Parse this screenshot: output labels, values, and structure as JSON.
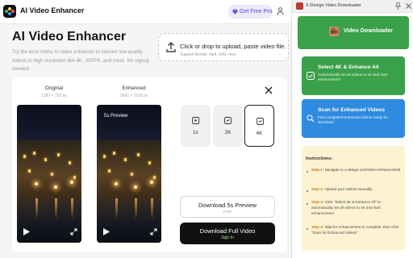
{
  "header": {
    "app_name": "AI Video Enhancer",
    "pro_label": "Get Free Pro"
  },
  "hero": {
    "title": "AI Video Enhancer",
    "description": "Try the best online AI video enhancer to convert low-quality videos to high resolution like 4K, 30FPS, and more. No signup needed."
  },
  "upload": {
    "main": "Click or drop to upload, paste video file.",
    "sub": "Support format: mp4, m4v, mov"
  },
  "compare": {
    "original_label": "Original",
    "original_res": "1280 × 720 px",
    "enhanced_label": "Enhanced",
    "enhanced_res": "3840 × 2160 px",
    "preview_tag": "5s Preview"
  },
  "resolutions": [
    {
      "label": "1x",
      "icon": "play-icon",
      "selected": false
    },
    {
      "label": "2K",
      "icon": "2k-icon",
      "selected": false
    },
    {
      "label": "4K",
      "icon": "4k-icon",
      "selected": true
    }
  ],
  "actions": {
    "preview_label": "Download 5s Preview",
    "preview_sub": "Free",
    "full_label": "Download Full Video",
    "full_sub": "Sign In"
  },
  "extension": {
    "title": "X-Design Video Downloader",
    "header": "Video Downloader",
    "cards": [
      {
        "title": "Select 4K & Enhance All",
        "desc": "Automatically set all videos to 4K and start enhancement",
        "color": "#3aa04a",
        "icon": "enhance-icon"
      },
      {
        "title": "Scan for Enhanced Videos",
        "desc": "Find completed enhanced videos ready for download",
        "color": "#2f8be0",
        "icon": "search-icon"
      }
    ],
    "instructions_title": "Instructions:",
    "steps": [
      {
        "label": "Step 1:",
        "text": "Navigate to x-design.com/video-enhancer/edit"
      },
      {
        "label": "Step 2:",
        "text": "Upload your videos manually"
      },
      {
        "label": "Step 3:",
        "text": "Click \"Select 4K & Enhance All\" to automatically set all videos to 4K and start enhancement"
      },
      {
        "label": "Step 4:",
        "text": "Wait for enhancement to complete, then click \"Scan for Enhanced Videos\""
      }
    ]
  }
}
